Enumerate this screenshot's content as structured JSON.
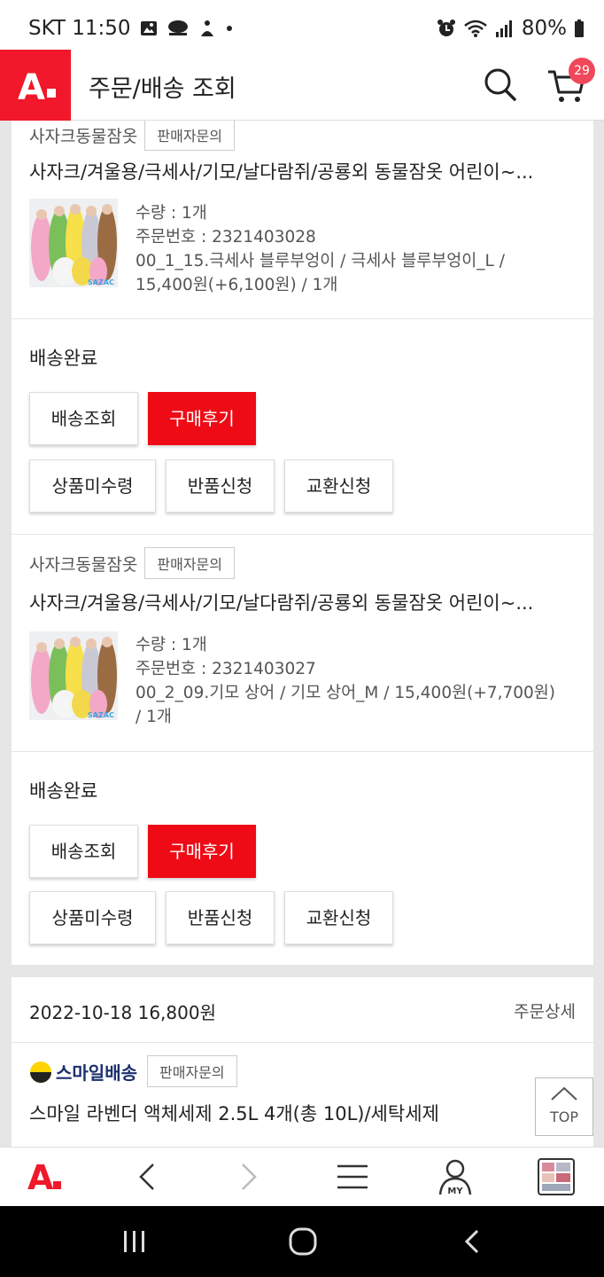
{
  "status_bar": {
    "carrier_time": "SKT 11:50",
    "battery": "80%"
  },
  "header": {
    "title": "주문/배송 조회",
    "logo_text": "A.",
    "cart_count": "29"
  },
  "orders": [
    {
      "seller": "사자크동물잠옷",
      "inquiry_label": "판매자문의",
      "title": "사자크/겨울용/극세사/기모/날다람쥐/공룡외 동물잠옷 어린이~...",
      "thumb_brand": "SAZAC",
      "details": [
        "수량 : 1개",
        "주문번호 : 2321403028",
        "00_1_15.극세사 블루부엉이 / 극세사 블루부엉이_L /",
        "15,400원(+6,100원) / 1개"
      ],
      "status": "배송완료",
      "buttons": [
        "배송조회",
        "구매후기",
        "상품미수령",
        "반품신청",
        "교환신청"
      ]
    },
    {
      "seller": "사자크동물잠옷",
      "inquiry_label": "판매자문의",
      "title": "사자크/겨울용/극세사/기모/날다람쥐/공룡외 동물잠옷 어린이~...",
      "thumb_brand": "SAZAC",
      "details": [
        "수량 : 1개",
        "주문번호 : 2321403027",
        "00_2_09.기모 상어 / 기모 상어_M / 15,400원(+7,700원)",
        "/ 1개"
      ],
      "status": "배송완료",
      "buttons": [
        "배송조회",
        "구매후기",
        "상품미수령",
        "반품신청",
        "교환신청"
      ]
    }
  ],
  "next_order": {
    "date_amount": "2022-10-18  16,800원",
    "detail_link": "주문상세",
    "seller_logo": "스마일배송",
    "inquiry_label": "판매자문의",
    "title": "스마일 라벤더 액체세제 2.5L 4개(총 10L)/세탁세제"
  },
  "top_button": "TOP",
  "bottom_nav": {
    "logo": "A.",
    "my_label": "MY"
  },
  "icons": {
    "search": "search-icon",
    "cart": "cart-icon",
    "back": "chevron-left-icon",
    "forward": "chevron-right-icon",
    "menu": "menu-icon",
    "my": "user-icon",
    "tabs": "tabs-thumbnail-icon",
    "top": "chevron-up-icon"
  },
  "colors": {
    "brand_red": "#f0182a",
    "button_red": "#ee0b15",
    "badge": "#f0485a"
  }
}
